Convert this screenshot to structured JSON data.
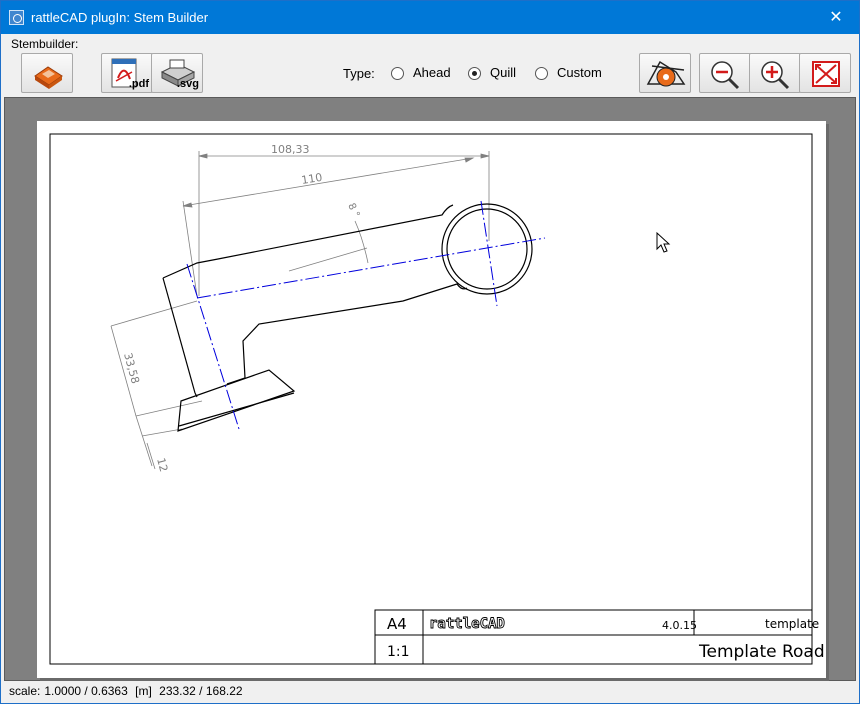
{
  "window": {
    "title": "rattleCAD plugIn: Stem Builder",
    "close_glyph": "✕"
  },
  "toolbar": {
    "group_label": "Stembuilder:",
    "buttons": [
      {
        "name": "save-button",
        "icon": "floppy-disk-icon",
        "caption": ""
      },
      {
        "name": "export-pdf-button",
        "icon": "pdf-export-icon",
        "caption": ".pdf"
      },
      {
        "name": "export-svg-button",
        "icon": "printer-svg-icon",
        "caption": ".svg"
      },
      {
        "name": "rattlecad-button",
        "icon": "rattlecad-logo-icon",
        "caption": ""
      },
      {
        "name": "zoom-out-button",
        "icon": "zoom-out-icon",
        "caption": ""
      },
      {
        "name": "zoom-in-button",
        "icon": "zoom-in-icon",
        "caption": ""
      },
      {
        "name": "fit-to-window-button",
        "icon": "fit-window-icon",
        "caption": ""
      }
    ],
    "type_label": "Type:",
    "type_options": [
      {
        "label": "Ahead",
        "selected": false
      },
      {
        "label": "Quill",
        "selected": true
      },
      {
        "label": "Custom",
        "selected": false
      }
    ]
  },
  "drawing": {
    "dimensions": {
      "top_length": "108,33",
      "length": "110",
      "angle": "8 °",
      "height": "33,58",
      "clamp": "12"
    },
    "title_block": {
      "format": "A4",
      "logo": "rattleCAD",
      "version": "4.0.15",
      "kind": "template",
      "scale": "1:1",
      "name": "Template Road"
    }
  },
  "status": {
    "scale_label": "scale:",
    "scale_value": "1.0000 / 0.6363",
    "unit": "[m]",
    "coords": "233.32 / 168.22"
  },
  "colors": {
    "titlebar": "#0078d7",
    "canvas": "#808080",
    "axis_line": "#0000dd",
    "dimension": "#808080"
  }
}
